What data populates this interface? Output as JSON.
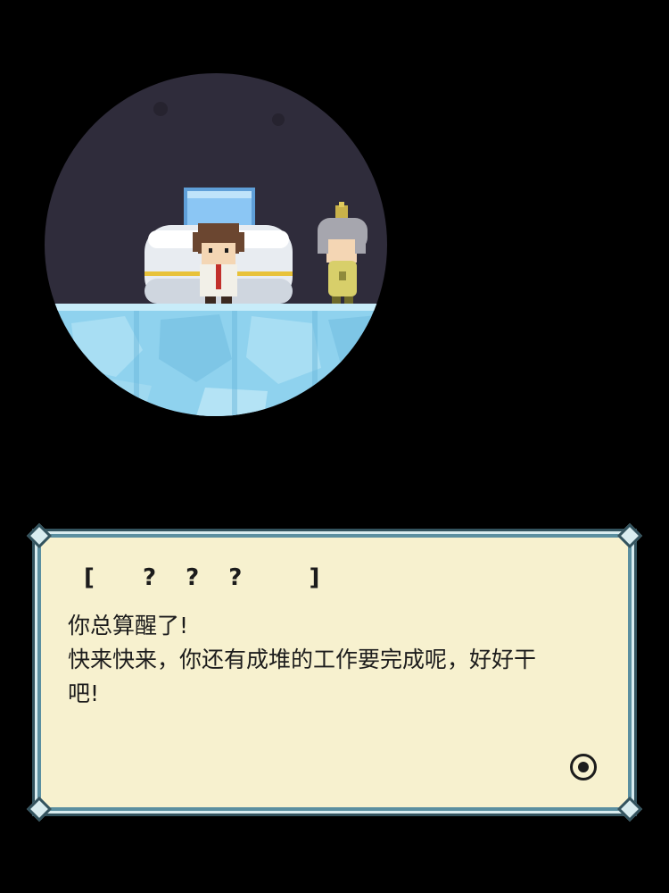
{
  "dialog": {
    "speaker": "[  ? ? ?   ]",
    "lines": [
      "你总算醒了!",
      "快来快来，你还有成堆的工作要完成呢，好好干",
      "吧!"
    ],
    "advance_icon": "advance-indicator-icon"
  },
  "scene": {
    "icons": [
      "cryo-pod-icon",
      "player-character-icon",
      "elderly-npc-icon",
      "ice-floor-icon"
    ]
  },
  "colors": {
    "background": "#000000",
    "dialog_bg": "#f7f1cf",
    "dialog_border": "#5b8fa0",
    "scene_bg": "#2f2c3b",
    "ice": "#8fd2ee"
  }
}
